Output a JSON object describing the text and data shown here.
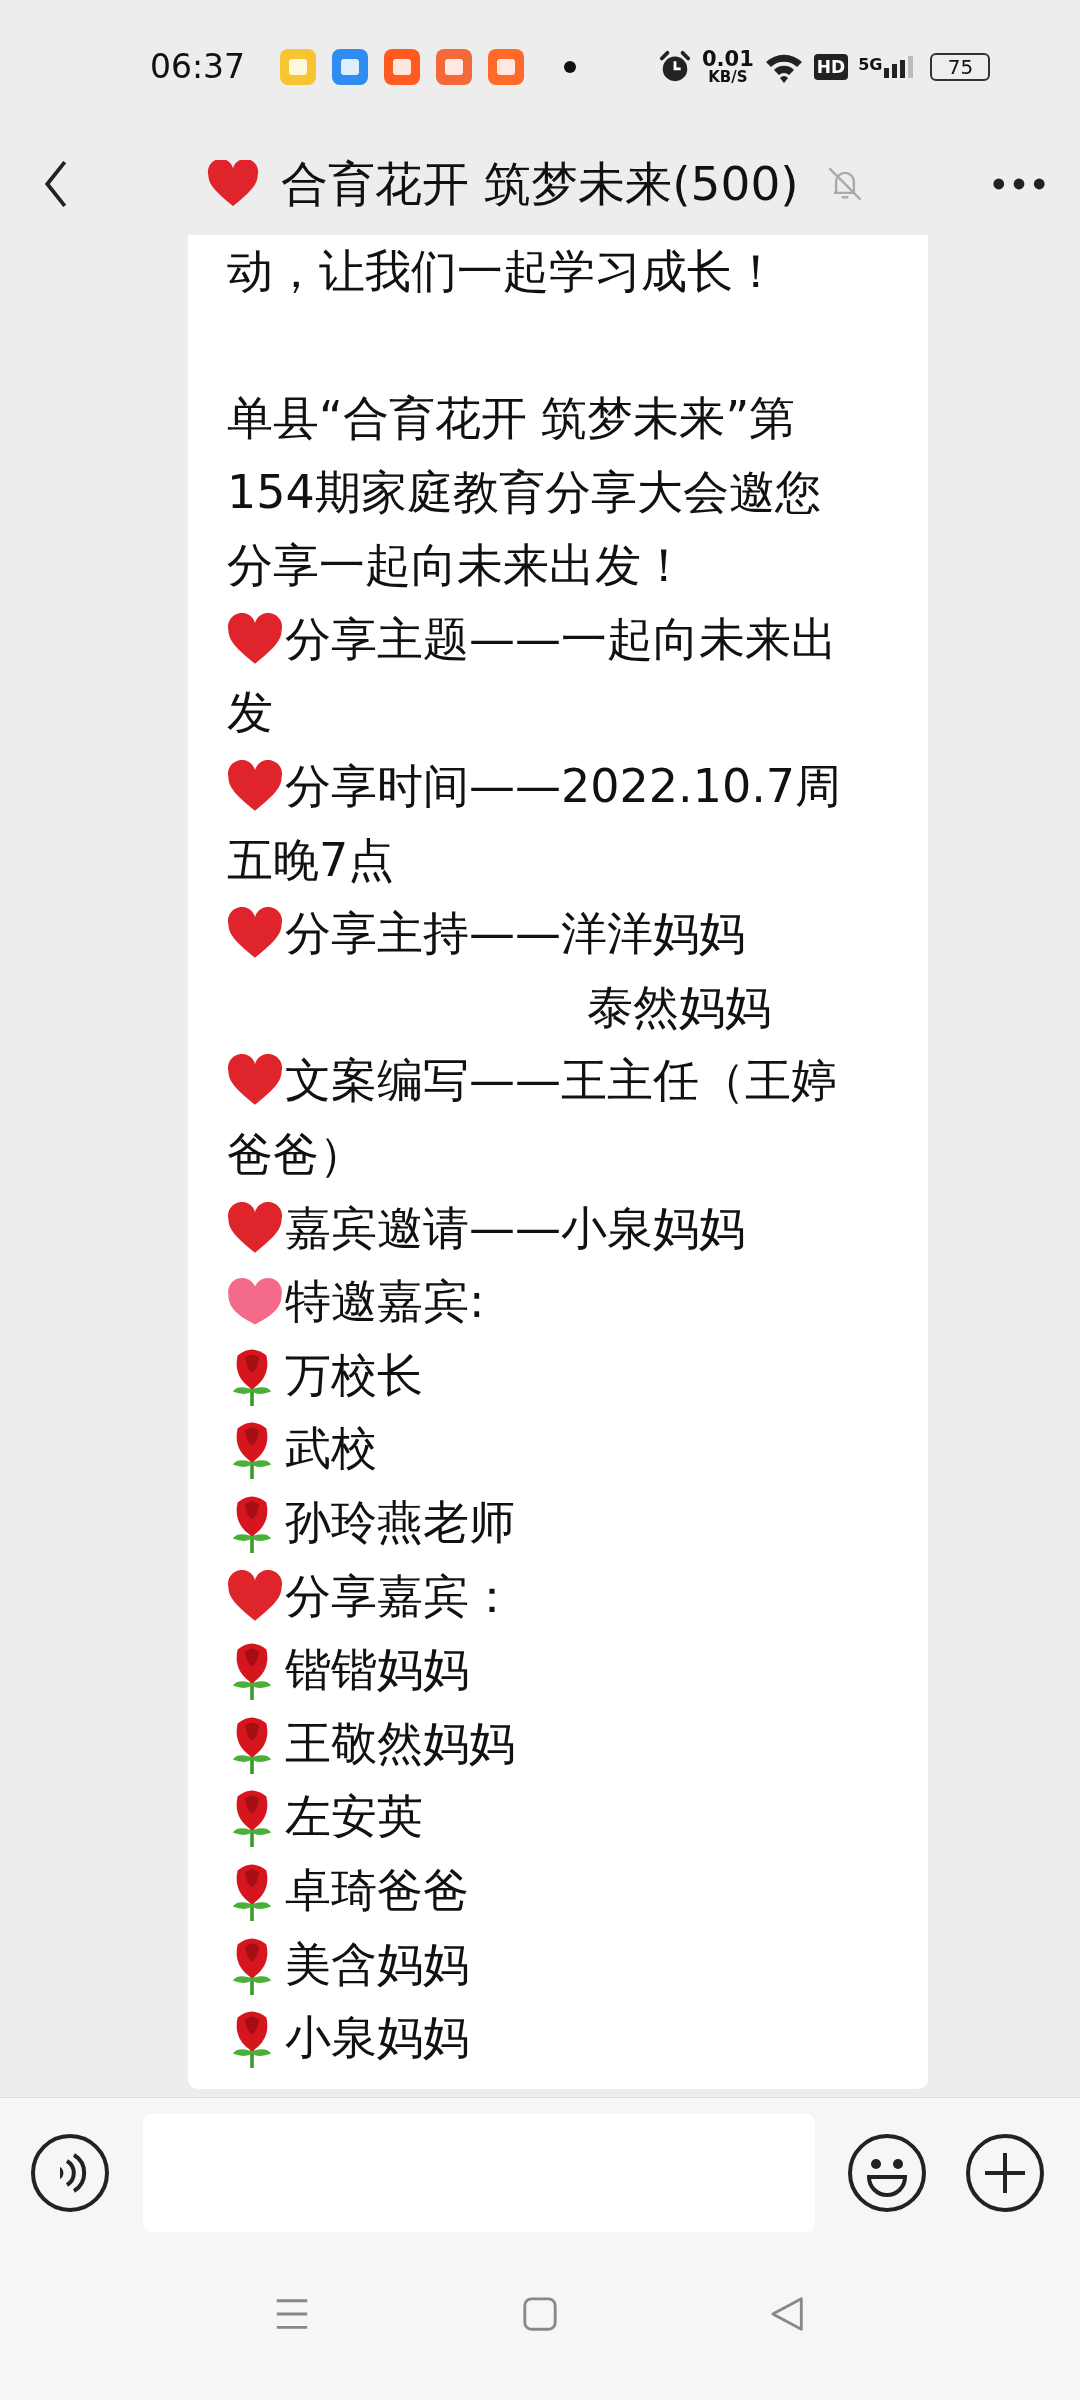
{
  "status_bar": {
    "time": "06:37",
    "net_speed": "0.01",
    "net_unit": "KB/S",
    "hd": "HD",
    "network": "5G",
    "battery": "75"
  },
  "header": {
    "title": "合育花开 筑梦未来(500)",
    "muted": true
  },
  "message": {
    "lines": [
      {
        "kind": "plain",
        "text": "动，让我们一起学习成长！"
      },
      {
        "kind": "plain",
        "text": "单县“合育花开 筑梦未来”第",
        "space_before": true
      },
      {
        "kind": "plain",
        "text": "154期家庭教育分享大会邀您"
      },
      {
        "kind": "plain",
        "text": "分享一起向未来出发！"
      },
      {
        "kind": "heart",
        "text": "分享主题——一起向未来出"
      },
      {
        "kind": "plain",
        "text": "发"
      },
      {
        "kind": "heart",
        "text": "分享时间——2022.10.7周"
      },
      {
        "kind": "plain",
        "text": "五晚7点"
      },
      {
        "kind": "heart",
        "text": "分享主持——洋洋妈妈"
      },
      {
        "kind": "indent",
        "text": "泰然妈妈"
      },
      {
        "kind": "heart",
        "text": "文案编写——王主任（王婷"
      },
      {
        "kind": "plain",
        "text": "爸爸）"
      },
      {
        "kind": "heart",
        "text": "嘉宾邀请——小泉妈妈"
      },
      {
        "kind": "pink_heart",
        "text": "特邀嘉宾:"
      },
      {
        "kind": "rose",
        "text": "万校长"
      },
      {
        "kind": "rose",
        "text": "武校"
      },
      {
        "kind": "rose",
        "text": "孙玲燕老师"
      },
      {
        "kind": "heart",
        "text": "分享嘉宾："
      },
      {
        "kind": "rose",
        "text": "锴锴妈妈"
      },
      {
        "kind": "rose",
        "text": "王敬然妈妈"
      },
      {
        "kind": "rose",
        "text": "左安英"
      },
      {
        "kind": "rose",
        "text": "卓琦爸爸"
      },
      {
        "kind": "rose",
        "text": "美含妈妈"
      },
      {
        "kind": "rose",
        "text": "小泉妈妈"
      }
    ]
  }
}
